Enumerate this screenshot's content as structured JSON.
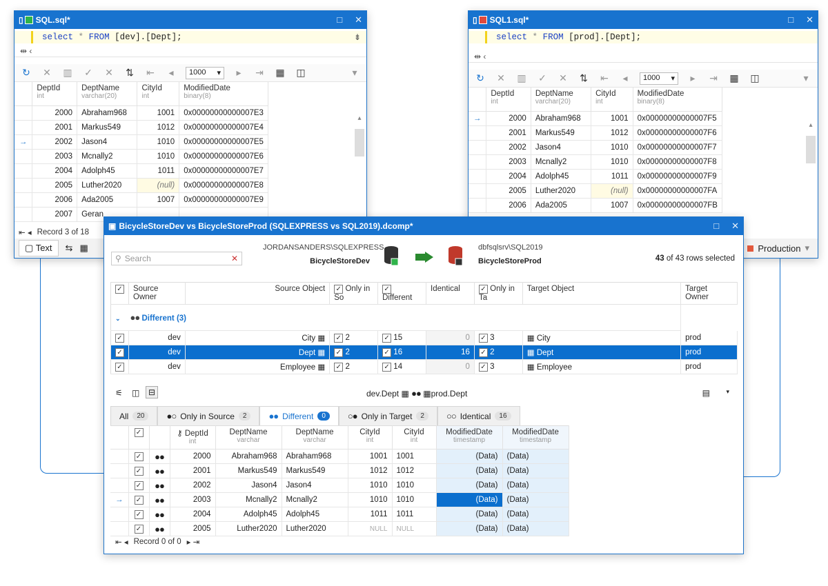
{
  "left_window": {
    "title": "SQL.sql*",
    "sql": {
      "kw1": "select",
      "star": "*",
      "kw2": "FROM",
      "rest": "[dev].[Dept];"
    },
    "rowcount": "1000",
    "columns": [
      {
        "name": "DeptId",
        "type": "int"
      },
      {
        "name": "DeptName",
        "type": "varchar(20)"
      },
      {
        "name": "CityId",
        "type": "int"
      },
      {
        "name": "ModifiedDate",
        "type": "binary(8)"
      }
    ],
    "rows": [
      [
        "2000",
        "Abraham968",
        "1001",
        "0x00000000000007E3"
      ],
      [
        "2001",
        "Markus549",
        "1012",
        "0x00000000000007E4"
      ],
      [
        "2002",
        "Jason4",
        "1010",
        "0x00000000000007E5"
      ],
      [
        "2003",
        "Mcnally2",
        "1010",
        "0x00000000000007E6"
      ],
      [
        "2004",
        "Adolph45",
        "1011",
        "0x00000000000007E7"
      ],
      [
        "2005",
        "Luther2020",
        "(null)",
        "0x00000000000007E8"
      ],
      [
        "2006",
        "Ada2005",
        "1007",
        "0x00000000000007E9"
      ],
      [
        "2007",
        "Geran",
        "",
        ""
      ]
    ],
    "status": "Record 3 of 18",
    "tab_text": "Text"
  },
  "right_window": {
    "title": "SQL1.sql*",
    "sql": {
      "kw1": "select",
      "star": "*",
      "kw2": "FROM",
      "rest": "[prod].[Dept];"
    },
    "rowcount": "1000",
    "columns": [
      {
        "name": "DeptId",
        "type": "int"
      },
      {
        "name": "DeptName",
        "type": "varchar(20)"
      },
      {
        "name": "CityId",
        "type": "int"
      },
      {
        "name": "ModifiedDate",
        "type": "binary(8)"
      }
    ],
    "rows": [
      [
        "2000",
        "Abraham968",
        "1001",
        "0x00000000000007F5"
      ],
      [
        "2001",
        "Markus549",
        "1012",
        "0x00000000000007F6"
      ],
      [
        "2002",
        "Jason4",
        "1010",
        "0x00000000000007F7"
      ],
      [
        "2003",
        "Mcnally2",
        "1010",
        "0x00000000000007F8"
      ],
      [
        "2004",
        "Adolph45",
        "1011",
        "0x00000000000007F9"
      ],
      [
        "2005",
        "Luther2020",
        "(null)",
        "0x00000000000007FA"
      ],
      [
        "2006",
        "Ada2005",
        "1007",
        "0x00000000000007FB"
      ]
    ],
    "connection": "Production"
  },
  "compare": {
    "title": "BicycleStoreDev vs BicycleStoreProd (SQLEXPRESS vs SQL2019).dcomp*",
    "search_placeholder": "Search",
    "source_server": "JORDANSANDERS\\SQLEXPRESS",
    "source_db": "BicycleStoreDev",
    "target_server": "dbfsqlsrv\\SQL2019",
    "target_db": "BicycleStoreProd",
    "rows_selected_count": "43",
    "rows_selected_text": "of 43 rows selected",
    "obj_headers": [
      "Source Owner",
      "Source Object",
      "Only in So",
      "Different",
      "Identical",
      "Only in Ta",
      "Target Object",
      "Target Owner"
    ],
    "group_label": "Different (3)",
    "objects": [
      [
        "dev",
        "City",
        "2",
        "15",
        "0",
        "3",
        "City",
        "prod"
      ],
      [
        "dev",
        "Dept",
        "2",
        "16",
        "16",
        "2",
        "Dept",
        "prod"
      ],
      [
        "dev",
        "Employee",
        "2",
        "14",
        "0",
        "3",
        "Employee",
        "prod"
      ]
    ],
    "detail_caption_src": "dev.Dept",
    "detail_caption_tgt": "prod.Dept",
    "tabs": [
      {
        "label": "All",
        "count": "20"
      },
      {
        "label": "Only in Source",
        "count": "2"
      },
      {
        "label": "Different",
        "count": "0"
      },
      {
        "label": "Only in Target",
        "count": "2"
      },
      {
        "label": "Identical",
        "count": "16"
      }
    ],
    "detail_headers": [
      {
        "name": "DeptId",
        "type": "int"
      },
      {
        "name": "DeptName",
        "type": "varchar"
      },
      {
        "name": "DeptName",
        "type": "varchar"
      },
      {
        "name": "CityId",
        "type": "int"
      },
      {
        "name": "CityId",
        "type": "int"
      },
      {
        "name": "ModifiedDate",
        "type": "timestamp"
      },
      {
        "name": "ModifiedDate",
        "type": "timestamp"
      }
    ],
    "detail_rows": [
      [
        "2000",
        "Abraham968",
        "Abraham968",
        "1001",
        "1001",
        "(Data)",
        "(Data)"
      ],
      [
        "2001",
        "Markus549",
        "Markus549",
        "1012",
        "1012",
        "(Data)",
        "(Data)"
      ],
      [
        "2002",
        "Jason4",
        "Jason4",
        "1010",
        "1010",
        "(Data)",
        "(Data)"
      ],
      [
        "2003",
        "Mcnally2",
        "Mcnally2",
        "1010",
        "1010",
        "(Data)",
        "(Data)"
      ],
      [
        "2004",
        "Adolph45",
        "Adolph45",
        "1011",
        "1011",
        "(Data)",
        "(Data)"
      ],
      [
        "2005",
        "Luther2020",
        "Luther2020",
        "NULL",
        "NULL",
        "(Data)",
        "(Data)"
      ]
    ],
    "status": "Record 0 of 0"
  }
}
